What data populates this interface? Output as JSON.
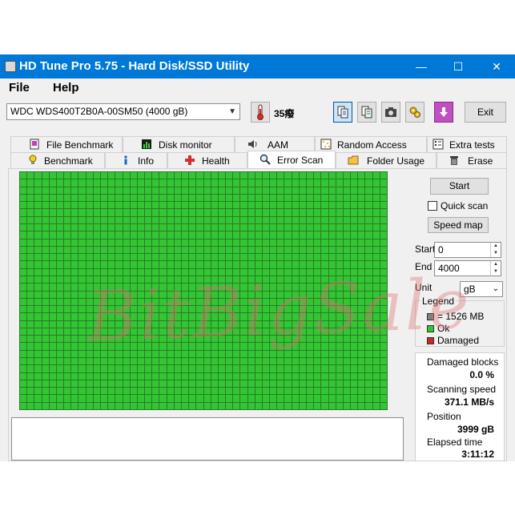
{
  "window": {
    "title": "HD Tune Pro 5.75 - Hard Disk/SSD Utility",
    "controls": {
      "minimize": "—",
      "maximize": "☐",
      "close": "✕"
    }
  },
  "menu": {
    "file": "File",
    "help": "Help"
  },
  "toolbar": {
    "drive": "WDC  WDS400T2B0A-00SM50 (4000 gB)",
    "temperature": "35",
    "temp_unit_glyph": "癈",
    "exit_label": "Exit"
  },
  "tabs": {
    "top": [
      {
        "label": "File Benchmark",
        "icon": "file-benchmark-icon"
      },
      {
        "label": "Disk monitor",
        "icon": "disk-monitor-icon"
      },
      {
        "label": "AAM",
        "icon": "speaker-icon"
      },
      {
        "label": "Random Access",
        "icon": "random-access-icon"
      },
      {
        "label": "Extra tests",
        "icon": "extra-tests-icon"
      }
    ],
    "bottom": [
      {
        "label": "Benchmark",
        "icon": "lightbulb-icon"
      },
      {
        "label": "Info",
        "icon": "info-icon"
      },
      {
        "label": "Health",
        "icon": "health-cross-icon"
      },
      {
        "label": "Error Scan",
        "icon": "magnifier-icon",
        "selected": true
      },
      {
        "label": "Folder Usage",
        "icon": "folder-icon"
      },
      {
        "label": "Erase",
        "icon": "trash-icon"
      }
    ]
  },
  "scan": {
    "start_button": "Start",
    "quick_scan_label": "Quick scan",
    "quick_scan_checked": false,
    "speed_map_button": "Speed map",
    "start_label": "Start",
    "start_value": "0",
    "end_label": "End",
    "end_value": "4000",
    "unit_label": "Unit",
    "unit_value": "gB"
  },
  "legend": {
    "title": "Legend",
    "items": [
      {
        "label": "= 1526 MB",
        "color": "#808080"
      },
      {
        "label": "Ok",
        "color": "#33c633"
      },
      {
        "label": "Damaged",
        "color": "#c62828"
      }
    ]
  },
  "stats": {
    "damaged_blocks_label": "Damaged blocks",
    "damaged_blocks_value": "0.0 %",
    "scanning_speed_label": "Scanning speed",
    "scanning_speed_value": "371.1 MB/s",
    "position_label": "Position",
    "position_value": "3999 gB",
    "elapsed_label": "Elapsed time",
    "elapsed_value": "3:11:12"
  },
  "block_map": {
    "columns": 50,
    "rows": 32,
    "ok_color": "#33c633",
    "grid_line_color": "#2b7a2b"
  },
  "watermark": "BitBigSale",
  "colors": {
    "titlebar": "#0078d7",
    "window_bg": "#f0f0f0"
  }
}
